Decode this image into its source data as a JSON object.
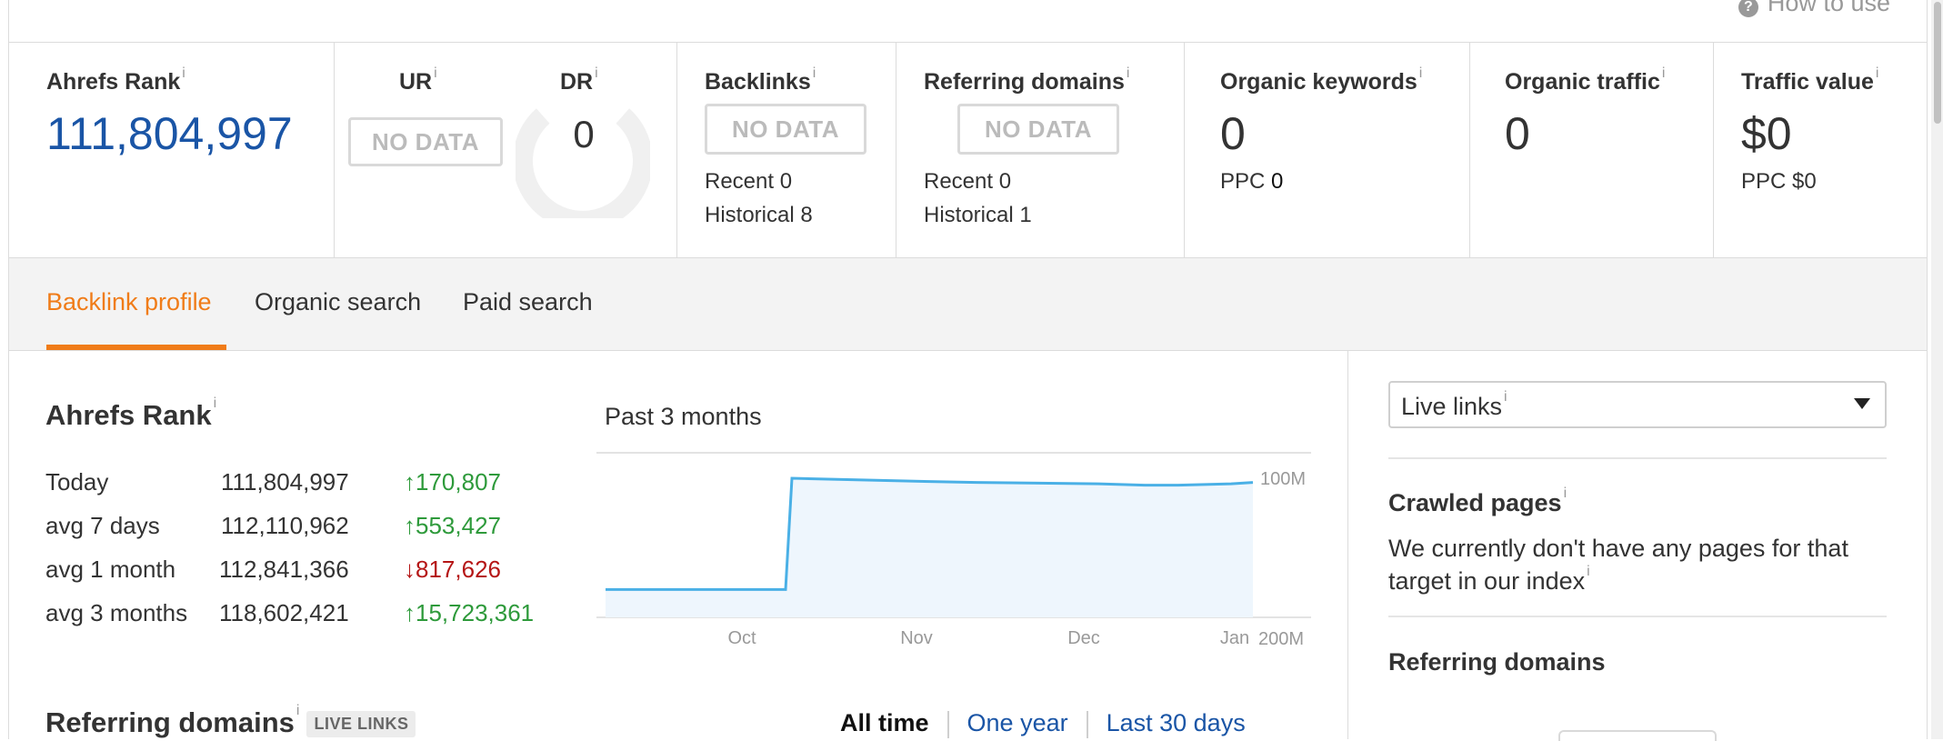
{
  "header": {
    "how_to_use": "How to use"
  },
  "metrics": {
    "ahrefs_rank": {
      "label": "Ahrefs Rank",
      "info": "i",
      "value": "111,804,997",
      "color": "#1a55a6"
    },
    "ur": {
      "label": "UR",
      "info": "i",
      "value": "NO DATA"
    },
    "dr": {
      "label": "DR",
      "info": "i",
      "value": "0"
    },
    "backlinks": {
      "label": "Backlinks",
      "info": "i",
      "value": "NO DATA",
      "recent": "Recent 0",
      "historical": "Historical 8"
    },
    "referring_domains": {
      "label": "Referring domains",
      "info": "i",
      "value": "NO DATA",
      "recent": "Recent 0",
      "historical": "Historical 1"
    },
    "organic_keywords": {
      "label": "Organic keywords",
      "info": "i",
      "value": "0",
      "ppc_label": "PPC",
      "ppc_value": "0"
    },
    "organic_traffic": {
      "label": "Organic traffic",
      "info": "i",
      "value": "0"
    },
    "traffic_value": {
      "label": "Traffic value",
      "info": "i",
      "value": "$0",
      "ppc": "PPC $0"
    }
  },
  "tabs": [
    {
      "label": "Backlink profile",
      "active": true
    },
    {
      "label": "Organic search",
      "active": false
    },
    {
      "label": "Paid search",
      "active": false
    }
  ],
  "ahrefs_rank_section": {
    "title": "Ahrefs Rank",
    "info": "i",
    "rows": [
      {
        "label": "Today",
        "value": "111,804,997",
        "change": "170,807",
        "direction": "up"
      },
      {
        "label": "avg 7 days",
        "value": "112,110,962",
        "change": "553,427",
        "direction": "up"
      },
      {
        "label": "avg 1 month",
        "value": "112,841,366",
        "change": "817,626",
        "direction": "down"
      },
      {
        "label": "avg 3 months",
        "value": "118,602,421",
        "change": "15,723,361",
        "direction": "up"
      }
    ],
    "arrow_up": "↑",
    "arrow_down": "↓",
    "colors": {
      "up": "#2e9a3b",
      "down": "#b51616",
      "line": "#4ab0e6",
      "fill": "#eef6fd"
    }
  },
  "chart_data": {
    "type": "area",
    "title": "Past 3 months",
    "x": [
      "Sep 26",
      "Oct 10",
      "Oct 11",
      "Oct 20",
      "Nov",
      "Nov 15",
      "Dec",
      "Dec 5",
      "Dec 15",
      "Jan"
    ],
    "values": [
      180,
      180,
      100,
      102,
      103,
      104,
      105,
      105,
      104,
      103
    ],
    "y_ticks": [
      "100M",
      "200M"
    ],
    "x_ticks": [
      "Oct",
      "Nov",
      "Dec",
      "Jan"
    ],
    "ylim": [
      100,
      200
    ],
    "y_inverted": true,
    "grid": true
  },
  "referring_domains_section": {
    "title": "Referring domains",
    "info": "i",
    "badge": "LIVE LINKS",
    "filters": [
      {
        "label": "All time",
        "active": true
      },
      {
        "label": "One year",
        "active": false
      },
      {
        "label": "Last 30 days",
        "active": false
      }
    ]
  },
  "sidebar": {
    "select_value": "Live links",
    "select_info": "i",
    "crawled_title": "Crawled pages",
    "crawled_info": "i",
    "crawled_text_1": "We currently don't have any pages for that",
    "crawled_text_2": "target in our index",
    "crawled_text_info": "i",
    "ref_title": "Referring domains"
  }
}
